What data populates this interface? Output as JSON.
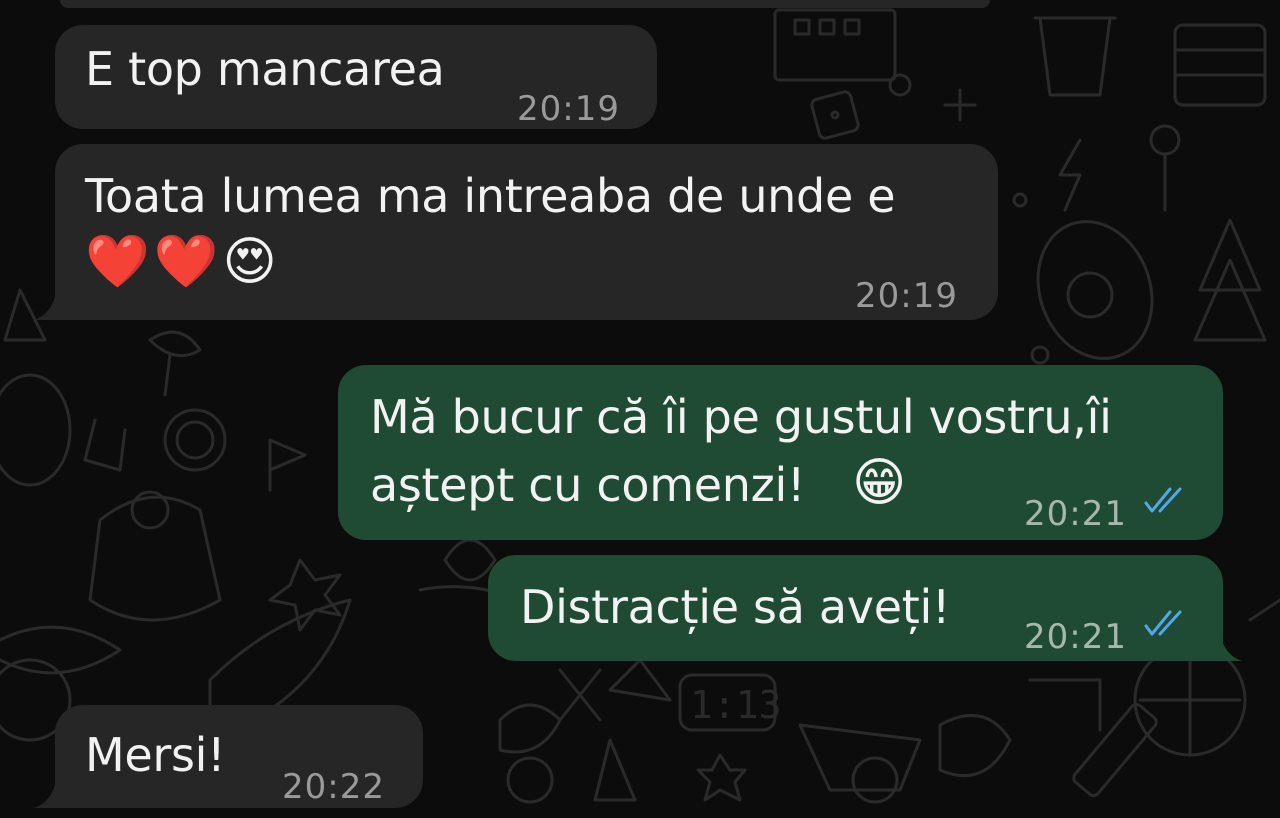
{
  "colors": {
    "background": "#0c0c0c",
    "incoming_bubble": "#262626",
    "outgoing_bubble": "#1f4a33",
    "timestamp": "#9a9a9a",
    "read_ticks": "#53a7e8"
  },
  "messages": [
    {
      "direction": "incoming",
      "text": "E top mancarea",
      "time": "20:19"
    },
    {
      "direction": "incoming",
      "text": "Toata lumea ma intreaba de unde e",
      "emojis": "❤️❤️😍",
      "time": "20:19"
    },
    {
      "direction": "outgoing",
      "line1": "Mă bucur că îi pe gustul vostru,îi",
      "line2": "aștept cu comenzi!",
      "emoji": "😁",
      "time": "20:21",
      "status": "read-double-check-icon"
    },
    {
      "direction": "outgoing",
      "text": "Distracție să aveți!",
      "time": "20:21",
      "status": "read-double-check-icon"
    },
    {
      "direction": "incoming",
      "text": "Mersi!",
      "time": "20:22"
    }
  ]
}
